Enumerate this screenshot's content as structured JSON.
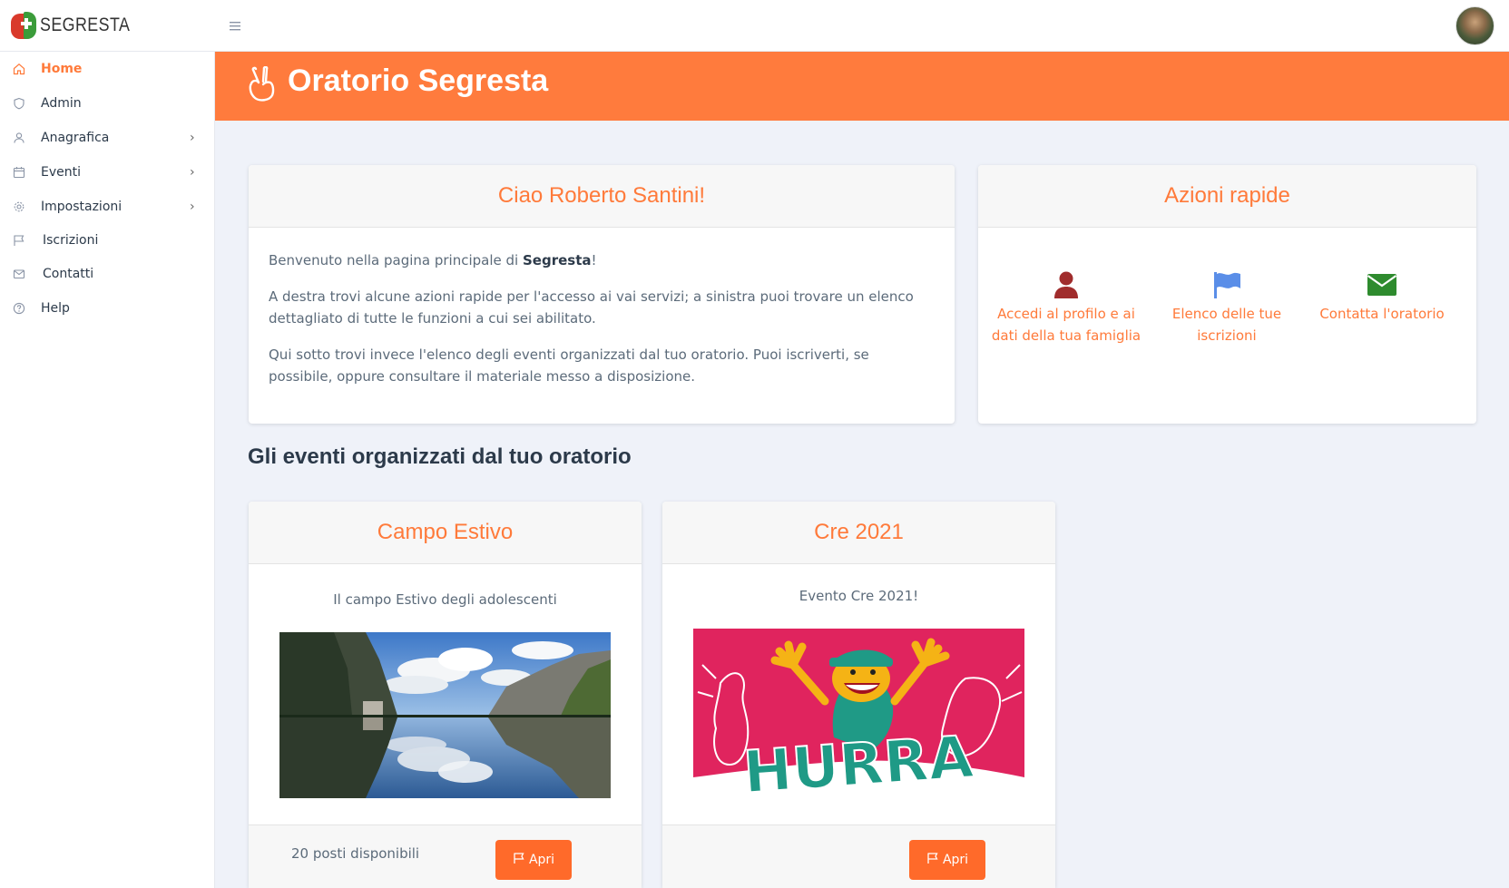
{
  "brand": {
    "name": "SEGRESTA"
  },
  "sidebar": {
    "items": [
      {
        "label": "Home",
        "icon": "home-icon",
        "active": true,
        "has_children": false
      },
      {
        "label": "Admin",
        "icon": "shield-icon",
        "active": false,
        "has_children": false
      },
      {
        "label": "Anagrafica",
        "icon": "user-icon",
        "active": false,
        "has_children": true
      },
      {
        "label": "Eventi",
        "icon": "calendar-icon",
        "active": false,
        "has_children": true
      },
      {
        "label": "Impostazioni",
        "icon": "gear-icon",
        "active": false,
        "has_children": true
      },
      {
        "label": "Iscrizioni",
        "icon": "flag-icon",
        "active": false,
        "has_children": false
      },
      {
        "label": "Contatti",
        "icon": "mail-icon",
        "active": false,
        "has_children": false
      },
      {
        "label": "Help",
        "icon": "help-icon",
        "active": false,
        "has_children": false
      }
    ]
  },
  "hero": {
    "title": "Oratorio Segresta",
    "icon": "hand-peace-icon"
  },
  "welcome": {
    "title": "Ciao Roberto Santini!",
    "p1_pre": "Benvenuto nella pagina principale di ",
    "p1_bold": "Segresta",
    "p1_post": "!",
    "p2": "A destra trovi alcune azioni rapide per l'accesso ai vai servizi; a sinistra puoi trovare un elenco dettagliato di tutte le funzioni a cui sei abilitato.",
    "p3": "Qui sotto trovi invece l'elenco degli eventi organizzati dal tuo oratorio. Puoi iscriverti, se possibile, oppure consultare il materiale messo a disposizione."
  },
  "quick_actions": {
    "title": "Azioni rapide",
    "items": [
      {
        "label": "Accedi al profilo e ai dati della tua famiglia",
        "icon": "user-icon",
        "color": "#a02c2c"
      },
      {
        "label": "Elenco delle tue iscrizioni",
        "icon": "flag-icon",
        "color": "#5a8ee8"
      },
      {
        "label": "Contatta l'oratorio",
        "icon": "envelope-icon",
        "color": "#2e8b2e"
      }
    ]
  },
  "events_section": {
    "title": "Gli eventi organizzati dal tuo oratorio"
  },
  "events": [
    {
      "title": "Campo Estivo",
      "description": "Il campo Estivo degli adolescenti",
      "spots": "20 posti disponibili",
      "button": "Apri",
      "image": "mountain-lake-photo"
    },
    {
      "title": "Cre 2021",
      "description": "Evento Cre 2021!",
      "spots": "",
      "button": "Apri",
      "image": "hurra-banner"
    }
  ],
  "colors": {
    "accent": "#ff7b3d",
    "background": "#eff2f9"
  }
}
